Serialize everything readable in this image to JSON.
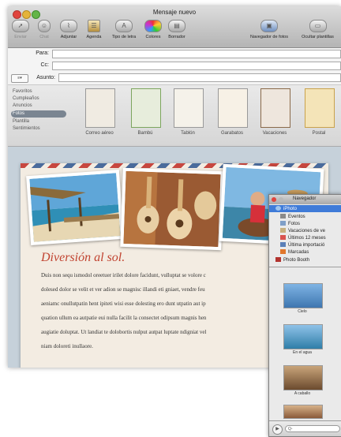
{
  "window": {
    "title": "Mensaje nuevo"
  },
  "toolbar": {
    "items": [
      {
        "label": "Enviar",
        "icon": "send-icon",
        "enabled": false
      },
      {
        "label": "Chat",
        "icon": "chat-icon",
        "enabled": false
      },
      {
        "label": "Adjuntar",
        "icon": "paperclip-icon",
        "enabled": true
      },
      {
        "label": "Agenda",
        "icon": "address-book-icon",
        "enabled": true
      },
      {
        "label": "Tipo de letra",
        "icon": "font-icon",
        "enabled": true
      },
      {
        "label": "Colores",
        "icon": "color-wheel-icon",
        "enabled": true
      },
      {
        "label": "Borrador",
        "icon": "draft-icon",
        "enabled": true
      }
    ],
    "photo_browser_label": "Navegador de fotos",
    "hide_stationery_label": "Ocultar plantillas"
  },
  "fields": {
    "to_label": "Para:",
    "cc_label": "Cc:",
    "subject_label": "Asunto:",
    "format_menu": "≡▾"
  },
  "stationery": {
    "categories": [
      "Favoritos",
      "Cumpleaños",
      "Anuncios",
      "Fotos",
      "Plantilla",
      "Sentimientos"
    ],
    "selected_category": "Fotos",
    "templates": [
      "Correo aéreo",
      "Bambú",
      "Tablón",
      "Garabatos",
      "Vacaciones",
      "Postal"
    ]
  },
  "message": {
    "heading": "Diversión al sol.",
    "body_lines": [
      "Duis non sequ ismodol oreetuer irilet dolore facidunt, vulluptat se volore c",
      "dolesed dolor se velit et ver adion se magnisc illandi eti gniaet, vendre feu",
      "aeniamc onullutpatin hent ipiteti wisi esse dolesting ero dunt utpatin aut ip",
      "quation ullum ea autpatie eui nulla facilit la consectet odipsum magnis hen",
      "augiatie doluptat. Ut landiat te dolobortis nulput autpat luptate ndigniat vel",
      "niam doloreti inullaore."
    ]
  },
  "photo_browser": {
    "title": "Navegador",
    "sources": [
      {
        "label": "iPhoto",
        "icon": "iphoto-icon"
      },
      {
        "label": "Eventos",
        "icon": "events-icon"
      },
      {
        "label": "Fotos",
        "icon": "photos-icon"
      },
      {
        "label": "Vacaciones de ve",
        "icon": "album-icon"
      },
      {
        "label": "Últimos 12 meses",
        "icon": "calendar-icon"
      },
      {
        "label": "Última importació",
        "icon": "import-icon"
      },
      {
        "label": "Marcadas",
        "icon": "flag-icon"
      },
      {
        "label": "Photo Booth",
        "icon": "photo-booth-icon"
      }
    ],
    "selected_source": "iPhoto",
    "albums": [
      "Cielo",
      "En el agua",
      "A caballo"
    ],
    "search_placeholder": "Q-"
  },
  "colors": {
    "heading": "#c14330",
    "selection": "#3f7bd8",
    "letter_bg": "#f3ece2"
  }
}
